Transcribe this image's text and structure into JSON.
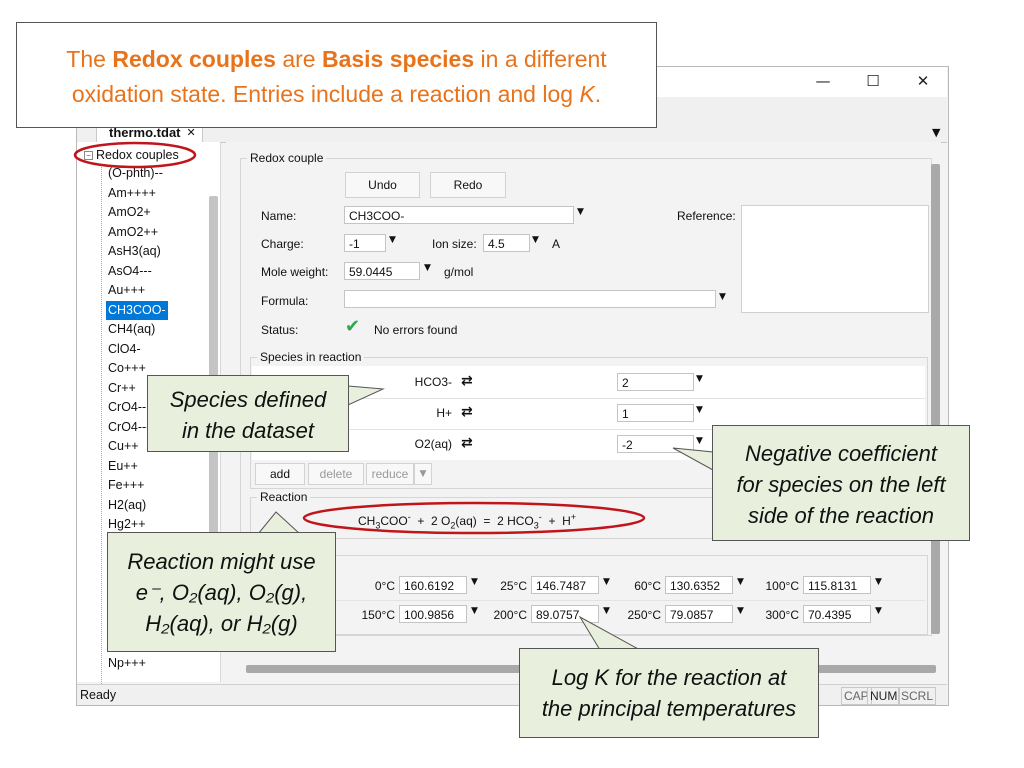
{
  "header": {
    "part1": "The ",
    "bold1": "Redox couples",
    "part2": " are ",
    "bold2": "Basis species",
    "part3": " in a different",
    "line2_a": "oxidation state. Entries include a reaction and log ",
    "line2_k": "K",
    "line2_end": "."
  },
  "window": {
    "controls": {
      "minimize": "—",
      "maximize": "☐",
      "close": "✕"
    },
    "tab": {
      "label": "thermo.tdat",
      "close": "✕"
    },
    "tab_menu_arrow": "▼"
  },
  "tree": {
    "root": "Redox couples",
    "items": [
      "(O-phth)--",
      "Am++++",
      "AmO2+",
      "AmO2++",
      "AsH3(aq)",
      "AsO4---",
      "Au+++",
      "CH3COO-",
      "CH4(aq)",
      "ClO4-",
      "Co+++",
      "Cr++",
      "CrO4--",
      "CrO4---",
      "Cu++",
      "Eu++",
      "Fe+++",
      "H2(aq)",
      "Hg2++"
    ],
    "selected_index": 7,
    "bottom_item": "Np+++"
  },
  "form": {
    "group_title": "Redox couple",
    "undo_label": "Undo",
    "redo_label": "Redo",
    "name_label": "Name:",
    "name_value": "CH3COO-",
    "reference_label": "Reference:",
    "charge_label": "Charge:",
    "charge_value": "-1",
    "ion_size_label": "Ion size:",
    "ion_size_value": "4.5",
    "ion_size_unit": "A",
    "mole_weight_label": "Mole weight:",
    "mole_weight_value": "59.0445",
    "mole_weight_unit": "g/mol",
    "formula_label": "Formula:",
    "formula_value": "",
    "status_label": "Status:",
    "status_value": "No errors found"
  },
  "species": {
    "title": "Species in reaction",
    "rows": [
      {
        "name": "HCO3-",
        "coef": "2"
      },
      {
        "name": "H+",
        "coef": "1"
      },
      {
        "name": "O2(aq)",
        "coef": "-2"
      }
    ],
    "add_label": "add",
    "delete_label": "delete",
    "reduce_label": "reduce"
  },
  "reaction": {
    "title": "Reaction",
    "equation": "CH3COO- + 2 O2(aq) = 2 HCO3- + H+"
  },
  "logk": {
    "row1": [
      {
        "temp": "0°C",
        "value": "160.6192"
      },
      {
        "temp": "25°C",
        "value": "146.7487"
      },
      {
        "temp": "60°C",
        "value": "130.6352"
      },
      {
        "temp": "100°C",
        "value": "115.8131"
      }
    ],
    "row2": [
      {
        "temp": "150°C",
        "value": "100.9856"
      },
      {
        "temp": "200°C",
        "value": "89.0757"
      },
      {
        "temp": "250°C",
        "value": "79.0857"
      },
      {
        "temp": "300°C",
        "value": "70.4395"
      }
    ]
  },
  "statusbar": {
    "text": "Ready",
    "cap": "CAP",
    "num": "NUM",
    "scrl": "SCRL"
  },
  "callouts": {
    "species_defined": [
      "Species defined",
      "in the dataset"
    ],
    "negative_coef": [
      "Negative coefficient",
      "for species on the left",
      "side of the reaction"
    ],
    "reaction_use": [
      "Reaction might use",
      "e⁻, O₂(aq), O₂(g),",
      "H₂(aq), or H₂(g)"
    ],
    "logk": [
      "Log K for the reaction at",
      "the principal temperatures"
    ]
  },
  "colors": {
    "accent": "#e8731a",
    "highlight_ring": "#c0151b",
    "callout_fill": "#e8efdc",
    "selection": "#0078d7",
    "check": "#2ea84a"
  }
}
